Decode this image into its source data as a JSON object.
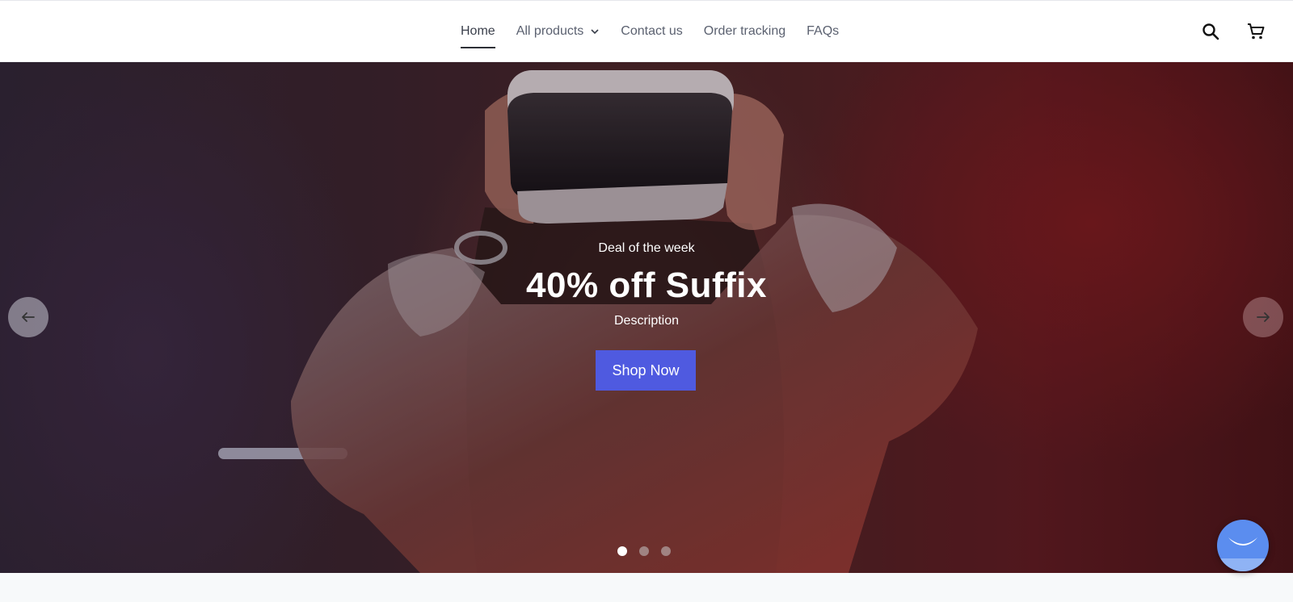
{
  "header": {
    "nav": [
      {
        "label": "Home",
        "active": true
      },
      {
        "label": "All products",
        "has_dropdown": true
      },
      {
        "label": "Contact us"
      },
      {
        "label": "Order tracking"
      },
      {
        "label": "FAQs"
      }
    ],
    "icons": [
      "search-icon",
      "cart-icon"
    ]
  },
  "hero": {
    "eyebrow": "Deal of the week",
    "headline": "40% off Suffix",
    "description": "Description",
    "cta_label": "Shop Now",
    "slide_count": 3,
    "active_slide": 1
  },
  "colors": {
    "accent": "#4f5ae0",
    "chat": "#5b8def"
  }
}
